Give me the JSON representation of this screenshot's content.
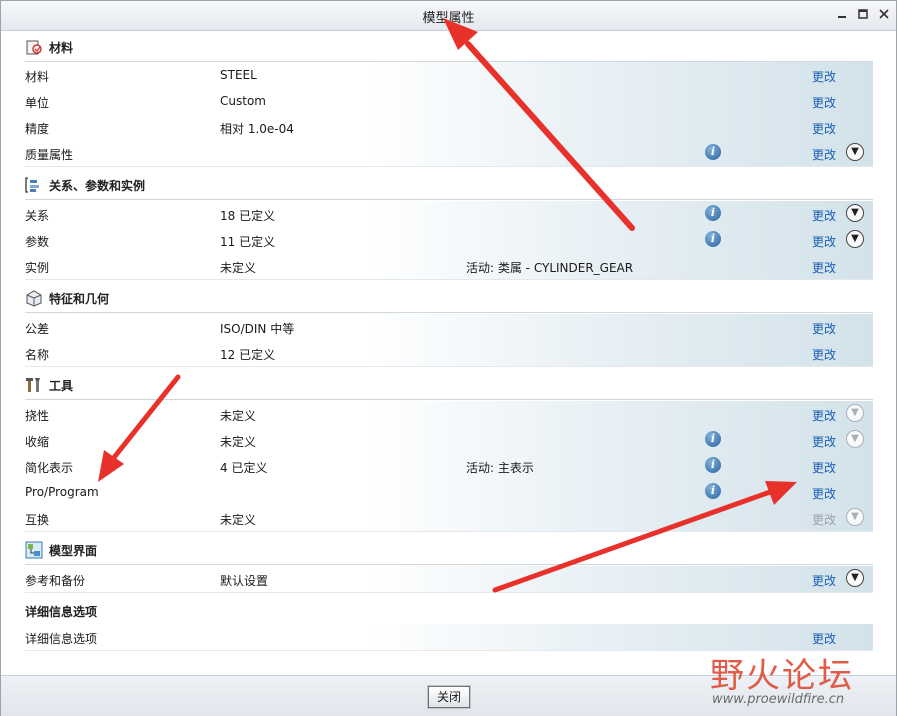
{
  "window": {
    "title": "模型属性",
    "minimize": "▭",
    "maximize": "□",
    "close": "✕"
  },
  "sections": {
    "materials": {
      "title": "材料",
      "rows": [
        {
          "label": "材料",
          "value": "STEEL",
          "change": "更改"
        },
        {
          "label": "单位",
          "value": "Custom",
          "change": "更改"
        },
        {
          "label": "精度",
          "value": "相对 1.0e-04",
          "change": "更改"
        },
        {
          "label": "质量属性",
          "value": "",
          "info": "i",
          "change": "更改"
        }
      ]
    },
    "relations": {
      "title": "关系、参数和实例",
      "rows": [
        {
          "label": "关系",
          "value": "18 已定义",
          "info": "i",
          "change": "更改"
        },
        {
          "label": "参数",
          "value": "11 已定义",
          "info": "i",
          "change": "更改"
        },
        {
          "label": "实例",
          "value": "未定义",
          "extra": "活动: 类属 - CYLINDER_GEAR",
          "change": "更改"
        }
      ]
    },
    "features": {
      "title": "特征和几何",
      "rows": [
        {
          "label": "公差",
          "value": "ISO/DIN 中等",
          "change": "更改"
        },
        {
          "label": "名称",
          "value": "12 已定义",
          "change": "更改"
        }
      ]
    },
    "tools": {
      "title": "工具",
      "rows": [
        {
          "label": "挠性",
          "value": "未定义",
          "change": "更改"
        },
        {
          "label": "收缩",
          "value": "未定义",
          "info": "i",
          "change": "更改"
        },
        {
          "label": "简化表示",
          "value": "4 已定义",
          "extra": "活动: 主表示",
          "info": "i",
          "change": "更改"
        },
        {
          "label": "Pro/Program",
          "value": "",
          "info": "i",
          "change": "更改"
        },
        {
          "label": "互换",
          "value": "未定义",
          "change": "更改"
        }
      ]
    },
    "interface": {
      "title": "模型界面",
      "rows": [
        {
          "label": "参考和备份",
          "value": "默认设置",
          "change": "更改"
        }
      ]
    },
    "detail": {
      "title": "详细信息选项",
      "rows": [
        {
          "label": "详细信息选项",
          "value": "",
          "change": "更改"
        }
      ]
    }
  },
  "footer": {
    "close_label": "关闭"
  },
  "watermark": {
    "main": "野火论坛",
    "url": "www.proewildfire.cn"
  },
  "colors": {
    "link": "#1a5fb4",
    "arrow": "#e8312a"
  }
}
